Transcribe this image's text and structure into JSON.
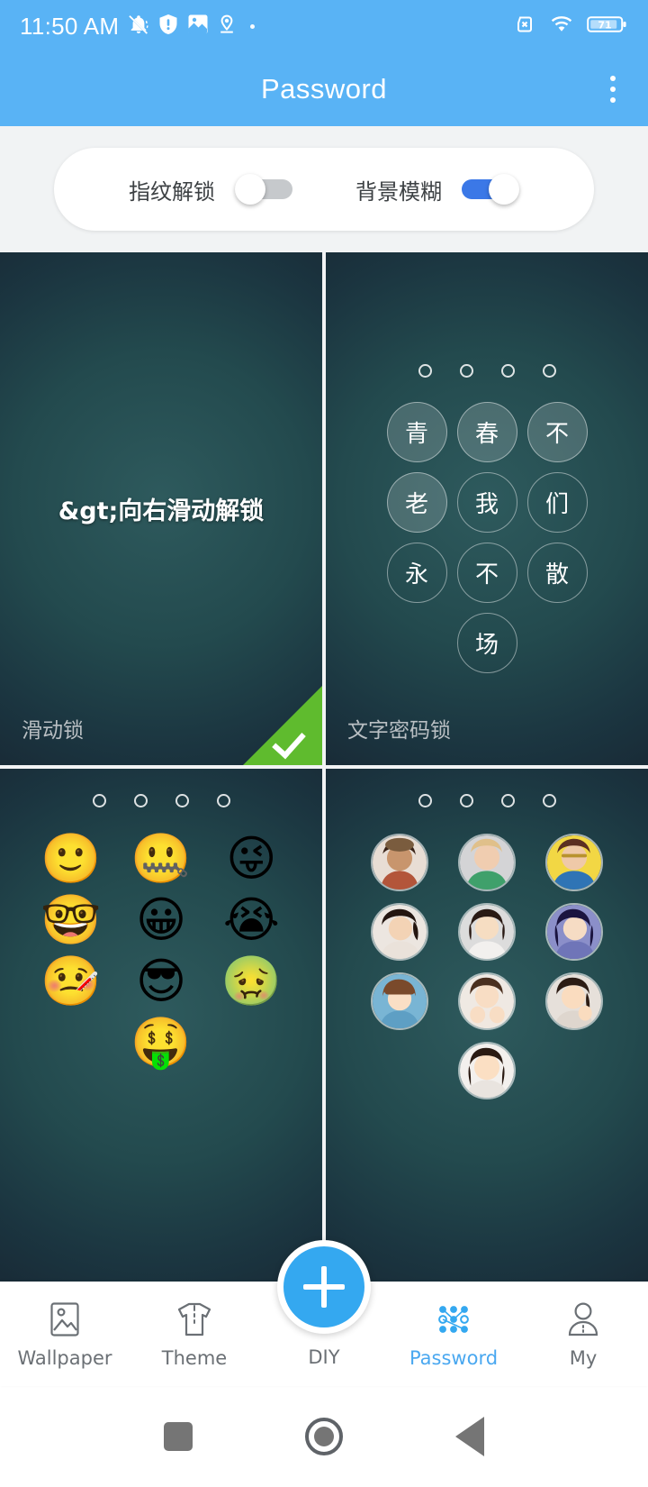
{
  "status_bar": {
    "time": "11:50 AM",
    "left_icons": [
      "mute-bell-icon",
      "shield-alert-icon",
      "gallery-image-icon",
      "location-pin-icon",
      "more-dot-icon"
    ],
    "right_icons": [
      "no-sim-icon",
      "wifi-icon",
      "battery-icon"
    ],
    "battery_level": "71"
  },
  "app_bar": {
    "title": "Password",
    "overflow_icon": "more-vert-icon"
  },
  "settings": {
    "fingerprint": {
      "label": "指纹解锁",
      "on": false
    },
    "blur": {
      "label": "背景模糊",
      "on": true
    }
  },
  "accent_color": "#59b3f5",
  "selected_color": "#5fbb2e",
  "locks": [
    {
      "id": "slide-lock",
      "name": "滑动锁",
      "hint": "&gt;向右滑动解锁",
      "selected": true,
      "type": "slide"
    },
    {
      "id": "text-password-lock",
      "name": "文字密码锁",
      "selected": false,
      "type": "chars",
      "keys": [
        "青",
        "春",
        "不",
        "老",
        "我",
        "们",
        "永",
        "不",
        "散",
        "场"
      ],
      "filled_indices": [
        0,
        1,
        2,
        3
      ],
      "dots": 4
    },
    {
      "id": "emoji-lock",
      "name": "",
      "selected": false,
      "type": "emoji",
      "keys": [
        "🙂",
        "🤐",
        "😜",
        "🤓",
        "😀",
        "😭",
        "🤒",
        "😎",
        "🤢",
        "🤑"
      ],
      "dots": 4
    },
    {
      "id": "photo-lock",
      "name": "",
      "selected": false,
      "type": "photo",
      "keys": [
        "portrait-hat-brunette",
        "portrait-blonde-grey",
        "portrait-glasses-yellow",
        "portrait-laughing-dark",
        "portrait-shortbob-grey",
        "portrait-bluehair",
        "portrait-bangs-blue",
        "portrait-hands-chin",
        "portrait-sidehair"
      ],
      "last_key": "portrait-smiling-white",
      "dots": 4
    }
  ],
  "bottom_nav": [
    {
      "label": "Wallpaper",
      "icon": "wallpaper-icon",
      "active": false
    },
    {
      "label": "Theme",
      "icon": "tshirt-icon",
      "active": false
    },
    {
      "label": "DIY",
      "icon": "plus-icon",
      "active": false
    },
    {
      "label": "Password",
      "icon": "pattern-lock-icon",
      "active": true
    },
    {
      "label": "My",
      "icon": "person-icon",
      "active": false
    }
  ],
  "system_nav": {
    "recents": "recents-square-icon",
    "home": "home-circle-icon",
    "back": "back-triangle-icon"
  }
}
